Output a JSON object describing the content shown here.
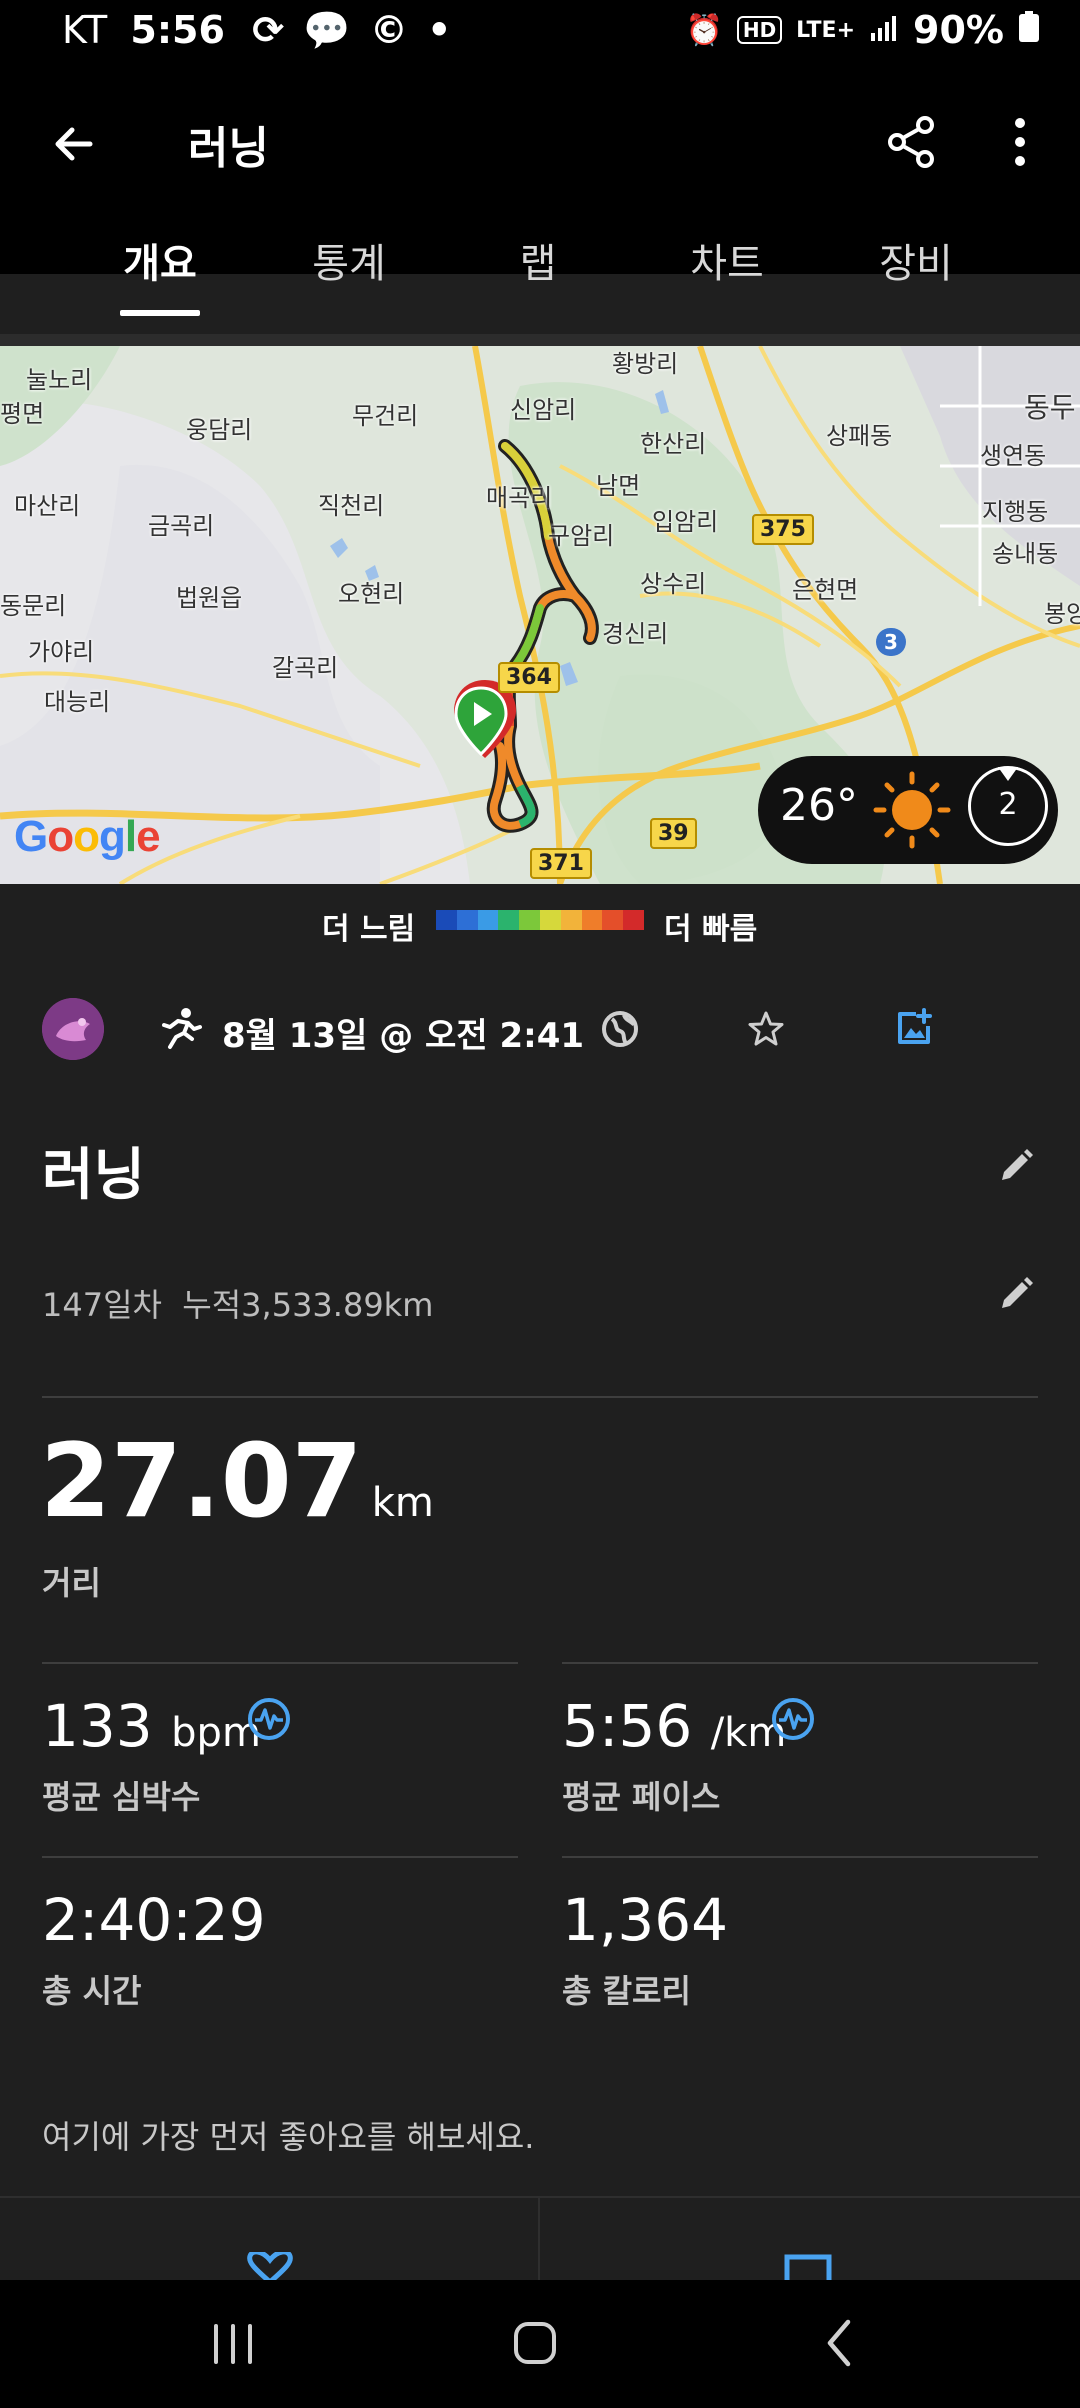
{
  "status_bar": {
    "carrier": "KT",
    "time": "5:56",
    "battery": "90%",
    "network": "LTE+",
    "hd": "HD"
  },
  "app_bar": {
    "title": "러닝"
  },
  "tabs": [
    {
      "label": "개요"
    },
    {
      "label": "통계"
    },
    {
      "label": "랩"
    },
    {
      "label": "차트"
    },
    {
      "label": "장비"
    }
  ],
  "map": {
    "labels": [
      "눌노리",
      "평면",
      "웅담리",
      "무건리",
      "신암리",
      "황방리",
      "한산리",
      "상패동",
      "동두",
      "생연동",
      "마산리",
      "금곡리",
      "직천리",
      "매곡리",
      "남면",
      "입암리",
      "구암리",
      "지행동",
      "송내동",
      "동문리",
      "법원읍",
      "오현리",
      "상수리",
      "은현면",
      "경신리",
      "봉양",
      "가야리",
      "갈곡리",
      "대능리"
    ],
    "road_numbers": [
      "375",
      "364",
      "371",
      "39",
      "3"
    ],
    "weather": {
      "temperature": "26°",
      "wind_speed": "2"
    },
    "attribution": "Google"
  },
  "legend": {
    "slow": "더 느림",
    "fast": "더 빠름",
    "colors": [
      "#1a4bb8",
      "#2d6fd6",
      "#3a9be6",
      "#2bb36d",
      "#7cc83a",
      "#d6d83b",
      "#f2b33a",
      "#ef7d2a",
      "#e44f2a",
      "#d32a2a"
    ]
  },
  "activity": {
    "datetime": "8월 13일 @ 오전 2:41",
    "name": "러닝",
    "description": "147일차  누적3,533.89km"
  },
  "stats": {
    "distance": {
      "value": "27.07",
      "unit": "km",
      "label": "거리"
    },
    "heart_rate": {
      "value": "133",
      "unit": "bpm",
      "label": "평균 심박수"
    },
    "pace": {
      "value": "5:56",
      "unit": "/km",
      "label": "평균 페이스"
    },
    "time": {
      "value": "2:40:29",
      "label": "총 시간"
    },
    "calories": {
      "value": "1,364",
      "label": "총 칼로리"
    }
  },
  "like_prompt": "여기에 가장 먼저 좋아요를 해보세요.",
  "colors": {
    "accent": "#4aa3f0",
    "background": "#1f1f1f"
  }
}
